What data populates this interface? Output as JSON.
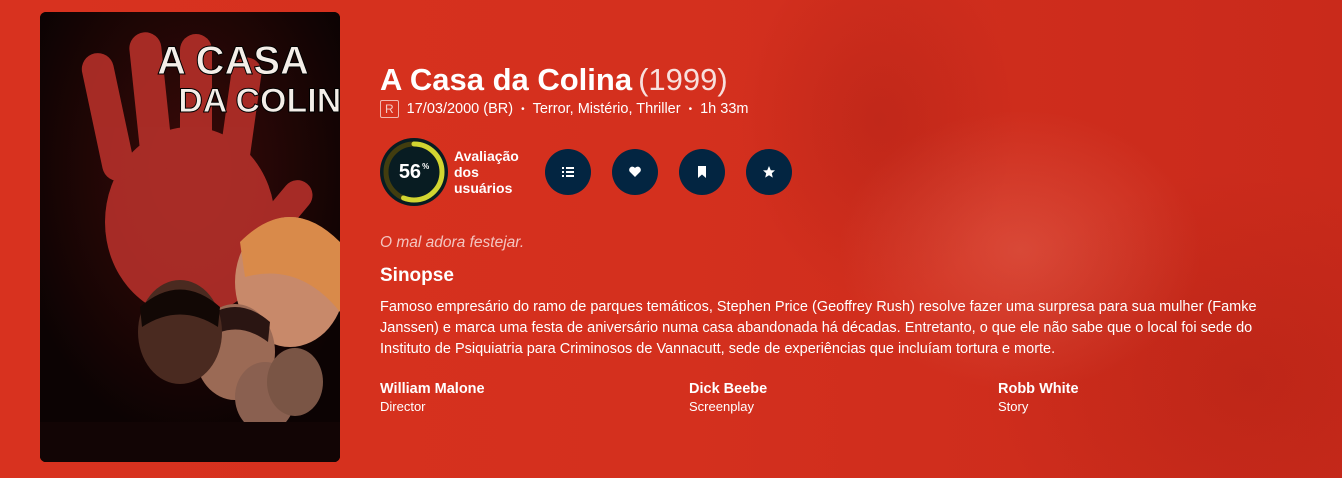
{
  "poster": {
    "title_line1": "A CASA",
    "title_line2": "DA COLINA"
  },
  "movie": {
    "title": "A Casa da Colina",
    "year": "(1999)",
    "certification": "R",
    "release": "17/03/2000 (BR)",
    "genres": "Terror, Mistério, Thriller",
    "runtime": "1h 33m",
    "separator": "•",
    "score": "56",
    "score_unit": "%",
    "score_fraction": 0.56,
    "score_label": "Avaliação dos usuários",
    "tagline": "O mal adora festejar.",
    "overview_heading": "Sinopse",
    "overview": "Famoso empresário do ramo de parques temáticos, Stephen Price (Geoffrey Rush) resolve fazer uma surpresa para sua mulher (Famke Janssen) e marca uma festa de aniversário numa casa abandonada há décadas. Entretanto, o que ele não sabe que o local foi sede do Instituto de Psiquiatria para Criminosos de Vannacutt, sede de experiências que incluíam tortura e morte."
  },
  "actions": [
    {
      "icon": "list-icon"
    },
    {
      "icon": "heart-icon"
    },
    {
      "icon": "bookmark-icon"
    },
    {
      "icon": "star-icon"
    }
  ],
  "crew": [
    {
      "name": "William Malone",
      "job": "Director"
    },
    {
      "name": "Dick Beebe",
      "job": "Screenplay"
    },
    {
      "name": "Robb White",
      "job": "Story"
    }
  ],
  "colors": {
    "background": "#d6311f",
    "button": "#032541",
    "score_ring": "#d2d531",
    "score_track": "#423d0f",
    "score_bg": "#081c22"
  }
}
